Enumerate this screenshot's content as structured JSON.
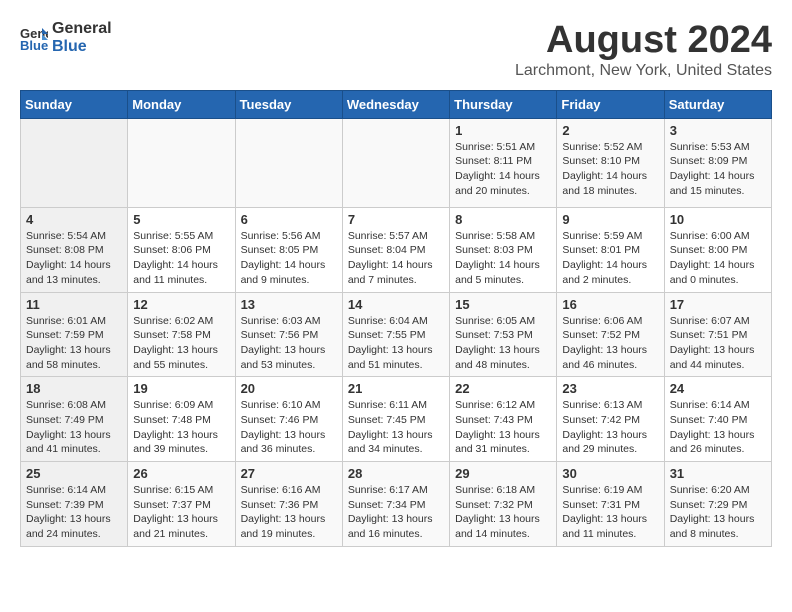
{
  "header": {
    "logo_general": "General",
    "logo_blue": "Blue",
    "title": "August 2024",
    "subtitle": "Larchmont, New York, United States"
  },
  "calendar": {
    "weekdays": [
      "Sunday",
      "Monday",
      "Tuesday",
      "Wednesday",
      "Thursday",
      "Friday",
      "Saturday"
    ],
    "weeks": [
      [
        {
          "day": "",
          "info": ""
        },
        {
          "day": "",
          "info": ""
        },
        {
          "day": "",
          "info": ""
        },
        {
          "day": "",
          "info": ""
        },
        {
          "day": "1",
          "info": "Sunrise: 5:51 AM\nSunset: 8:11 PM\nDaylight: 14 hours\nand 20 minutes."
        },
        {
          "day": "2",
          "info": "Sunrise: 5:52 AM\nSunset: 8:10 PM\nDaylight: 14 hours\nand 18 minutes."
        },
        {
          "day": "3",
          "info": "Sunrise: 5:53 AM\nSunset: 8:09 PM\nDaylight: 14 hours\nand 15 minutes."
        }
      ],
      [
        {
          "day": "4",
          "info": "Sunrise: 5:54 AM\nSunset: 8:08 PM\nDaylight: 14 hours\nand 13 minutes."
        },
        {
          "day": "5",
          "info": "Sunrise: 5:55 AM\nSunset: 8:06 PM\nDaylight: 14 hours\nand 11 minutes."
        },
        {
          "day": "6",
          "info": "Sunrise: 5:56 AM\nSunset: 8:05 PM\nDaylight: 14 hours\nand 9 minutes."
        },
        {
          "day": "7",
          "info": "Sunrise: 5:57 AM\nSunset: 8:04 PM\nDaylight: 14 hours\nand 7 minutes."
        },
        {
          "day": "8",
          "info": "Sunrise: 5:58 AM\nSunset: 8:03 PM\nDaylight: 14 hours\nand 5 minutes."
        },
        {
          "day": "9",
          "info": "Sunrise: 5:59 AM\nSunset: 8:01 PM\nDaylight: 14 hours\nand 2 minutes."
        },
        {
          "day": "10",
          "info": "Sunrise: 6:00 AM\nSunset: 8:00 PM\nDaylight: 14 hours\nand 0 minutes."
        }
      ],
      [
        {
          "day": "11",
          "info": "Sunrise: 6:01 AM\nSunset: 7:59 PM\nDaylight: 13 hours\nand 58 minutes."
        },
        {
          "day": "12",
          "info": "Sunrise: 6:02 AM\nSunset: 7:58 PM\nDaylight: 13 hours\nand 55 minutes."
        },
        {
          "day": "13",
          "info": "Sunrise: 6:03 AM\nSunset: 7:56 PM\nDaylight: 13 hours\nand 53 minutes."
        },
        {
          "day": "14",
          "info": "Sunrise: 6:04 AM\nSunset: 7:55 PM\nDaylight: 13 hours\nand 51 minutes."
        },
        {
          "day": "15",
          "info": "Sunrise: 6:05 AM\nSunset: 7:53 PM\nDaylight: 13 hours\nand 48 minutes."
        },
        {
          "day": "16",
          "info": "Sunrise: 6:06 AM\nSunset: 7:52 PM\nDaylight: 13 hours\nand 46 minutes."
        },
        {
          "day": "17",
          "info": "Sunrise: 6:07 AM\nSunset: 7:51 PM\nDaylight: 13 hours\nand 44 minutes."
        }
      ],
      [
        {
          "day": "18",
          "info": "Sunrise: 6:08 AM\nSunset: 7:49 PM\nDaylight: 13 hours\nand 41 minutes."
        },
        {
          "day": "19",
          "info": "Sunrise: 6:09 AM\nSunset: 7:48 PM\nDaylight: 13 hours\nand 39 minutes."
        },
        {
          "day": "20",
          "info": "Sunrise: 6:10 AM\nSunset: 7:46 PM\nDaylight: 13 hours\nand 36 minutes."
        },
        {
          "day": "21",
          "info": "Sunrise: 6:11 AM\nSunset: 7:45 PM\nDaylight: 13 hours\nand 34 minutes."
        },
        {
          "day": "22",
          "info": "Sunrise: 6:12 AM\nSunset: 7:43 PM\nDaylight: 13 hours\nand 31 minutes."
        },
        {
          "day": "23",
          "info": "Sunrise: 6:13 AM\nSunset: 7:42 PM\nDaylight: 13 hours\nand 29 minutes."
        },
        {
          "day": "24",
          "info": "Sunrise: 6:14 AM\nSunset: 7:40 PM\nDaylight: 13 hours\nand 26 minutes."
        }
      ],
      [
        {
          "day": "25",
          "info": "Sunrise: 6:14 AM\nSunset: 7:39 PM\nDaylight: 13 hours\nand 24 minutes."
        },
        {
          "day": "26",
          "info": "Sunrise: 6:15 AM\nSunset: 7:37 PM\nDaylight: 13 hours\nand 21 minutes."
        },
        {
          "day": "27",
          "info": "Sunrise: 6:16 AM\nSunset: 7:36 PM\nDaylight: 13 hours\nand 19 minutes."
        },
        {
          "day": "28",
          "info": "Sunrise: 6:17 AM\nSunset: 7:34 PM\nDaylight: 13 hours\nand 16 minutes."
        },
        {
          "day": "29",
          "info": "Sunrise: 6:18 AM\nSunset: 7:32 PM\nDaylight: 13 hours\nand 14 minutes."
        },
        {
          "day": "30",
          "info": "Sunrise: 6:19 AM\nSunset: 7:31 PM\nDaylight: 13 hours\nand 11 minutes."
        },
        {
          "day": "31",
          "info": "Sunrise: 6:20 AM\nSunset: 7:29 PM\nDaylight: 13 hours\nand 8 minutes."
        }
      ]
    ]
  }
}
